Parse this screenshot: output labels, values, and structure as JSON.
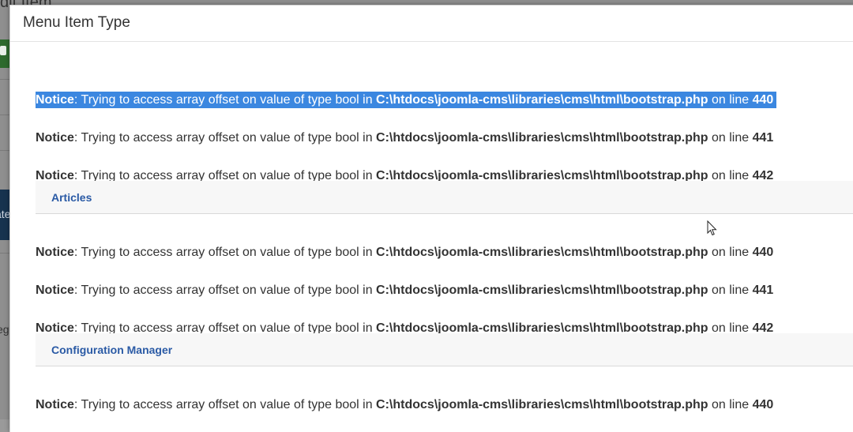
{
  "background": {
    "title_fragment": "dit Item",
    "navy_fragment": "ate",
    "small_fragment": "eg"
  },
  "modal": {
    "title": "Menu Item Type"
  },
  "notice_template": {
    "label": "Notice",
    "message": ": Trying to access array offset on value of type bool in ",
    "path": "C:\\htdocs\\joomla-cms\\libraries\\cms\\html\\bootstrap.php",
    "on_line": " on line "
  },
  "notices": [
    {
      "line": "440",
      "selected": true
    },
    {
      "line": "441",
      "selected": false
    },
    {
      "line": "442",
      "selected": false
    },
    {
      "line": "440",
      "selected": false
    },
    {
      "line": "441",
      "selected": false
    },
    {
      "line": "442",
      "selected": false
    },
    {
      "line": "440",
      "selected": false
    }
  ],
  "groups": [
    {
      "label": "Articles"
    },
    {
      "label": "Configuration Manager"
    }
  ],
  "colors": {
    "selection": "#3b87e0",
    "link": "#2a5aa5"
  }
}
